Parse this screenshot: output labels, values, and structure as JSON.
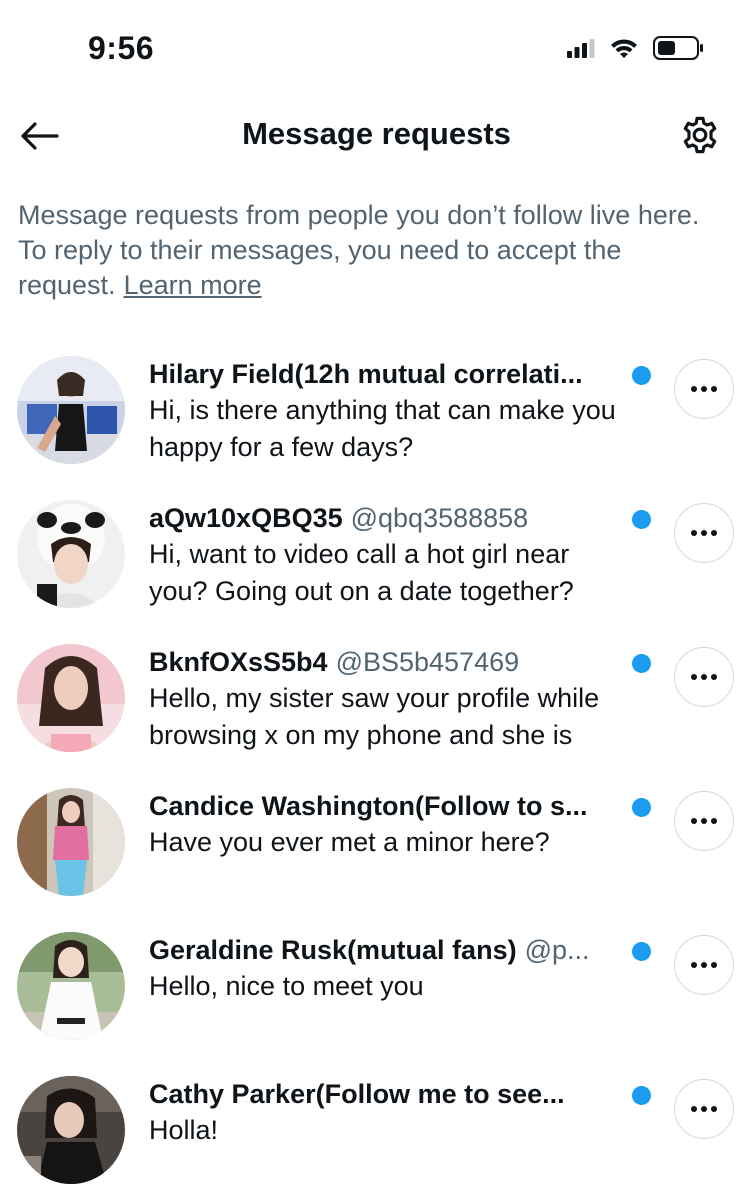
{
  "status_bar": {
    "time": "9:56"
  },
  "header": {
    "title": "Message requests",
    "back_icon": "arrow-left-icon",
    "settings_icon": "gear-icon"
  },
  "info": {
    "text": "Message requests from people you don’t follow live here. To reply to their messages, you need to accept the request.",
    "link": "Learn more"
  },
  "colors": {
    "accent": "#1d9bf0",
    "secondary_text": "#536471",
    "primary_text": "#0f1419",
    "border": "#cfd9de"
  },
  "requests": [
    {
      "name": "Hilary Field(12h mutual correlati...",
      "handle": "",
      "message": "Hi, is there anything that can make you happy for a few days?",
      "unread": true
    },
    {
      "name": "aQw10xQBQ35",
      "handle": "@qbq3588858",
      "message": "Hi, want to video call a hot girl near you? Going out on a date together?",
      "unread": true
    },
    {
      "name": "BknfOXsS5b4",
      "handle": "@BS5b457469",
      "message": "Hello, my sister saw your profile while browsing x on my phone and she is",
      "unread": true
    },
    {
      "name": "Candice Washington(Follow to s...",
      "handle": "",
      "message": "Have you ever met a minor here?",
      "unread": true
    },
    {
      "name": "Geraldine Rusk(mutual fans)",
      "handle": "@p...",
      "message": "Hello, nice to meet you",
      "unread": true
    },
    {
      "name": "Cathy Parker(Follow me to see...",
      "handle": "",
      "message": "Holla!",
      "unread": true
    }
  ]
}
